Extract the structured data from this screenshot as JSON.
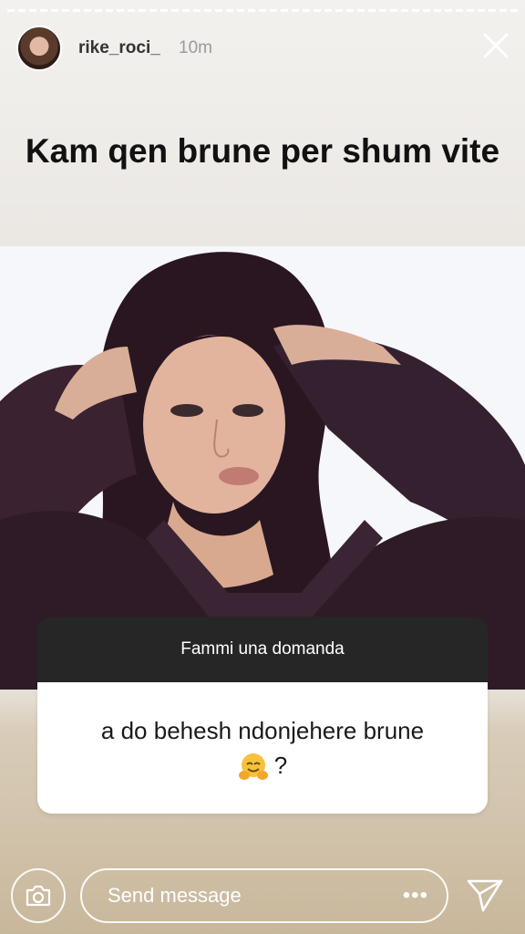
{
  "header": {
    "username": "rike_roci_",
    "time": "10m"
  },
  "story": {
    "title": "Kam qen brune per shum vite"
  },
  "question_sticker": {
    "prompt": "Fammi una domanda",
    "answer": "a do behesh ndonjehere brune",
    "answer_suffix": "?"
  },
  "footer": {
    "message_placeholder": "Send message",
    "more_label": "•••"
  },
  "icons": {
    "close": "close-icon",
    "camera": "camera-icon",
    "send": "send-icon",
    "emoji": "hugging-face-emoji"
  },
  "colors": {
    "sticker_header": "#262626",
    "sticker_body": "#ffffff"
  }
}
